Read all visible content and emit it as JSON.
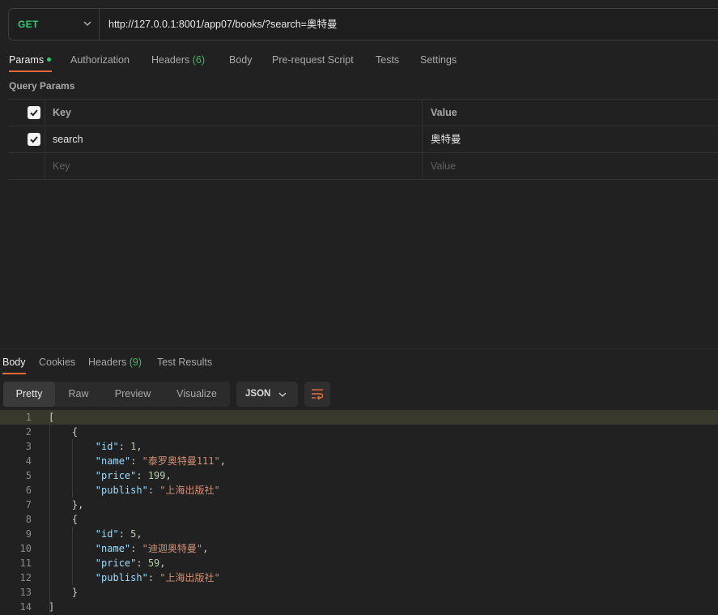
{
  "request": {
    "method": "GET",
    "url": "http://127.0.0.1:8001/app07/books/?search=奥特曼"
  },
  "request_tabs": {
    "params": "Params",
    "authorization": "Authorization",
    "headers": "Headers",
    "headers_count": "(6)",
    "body": "Body",
    "prerequest": "Pre-request Script",
    "tests": "Tests",
    "settings": "Settings"
  },
  "query_params": {
    "title": "Query Params",
    "header_key": "Key",
    "header_value": "Value",
    "rows": [
      {
        "key": "search",
        "value": "奥特曼",
        "checked": true
      }
    ],
    "placeholder_key": "Key",
    "placeholder_value": "Value"
  },
  "response_tabs": {
    "body": "Body",
    "cookies": "Cookies",
    "headers": "Headers",
    "headers_count": "(9)",
    "test_results": "Test Results"
  },
  "view_modes": [
    "Pretty",
    "Raw",
    "Preview",
    "Visualize"
  ],
  "format": "JSON",
  "response_lines": [
    {
      "n": "1",
      "text": "["
    },
    {
      "n": "2",
      "text": "    {"
    },
    {
      "n": "3",
      "key": "id",
      "value": "1",
      "type": "number",
      "comma": true
    },
    {
      "n": "4",
      "key": "name",
      "value": "\"泰罗奥特曼111\"",
      "type": "string",
      "comma": true
    },
    {
      "n": "5",
      "key": "price",
      "value": "199",
      "type": "number",
      "comma": true
    },
    {
      "n": "6",
      "key": "publish",
      "value": "\"上海出版社\"",
      "type": "string",
      "comma": false
    },
    {
      "n": "7",
      "text": "    },"
    },
    {
      "n": "8",
      "text": "    {"
    },
    {
      "n": "9",
      "key": "id",
      "value": "5",
      "type": "number",
      "comma": true
    },
    {
      "n": "10",
      "key": "name",
      "value": "\"迪迦奥特曼\"",
      "type": "string",
      "comma": true
    },
    {
      "n": "11",
      "key": "price",
      "value": "59",
      "type": "number",
      "comma": true
    },
    {
      "n": "12",
      "key": "publish",
      "value": "\"上海出版社\"",
      "type": "string",
      "comma": false
    },
    {
      "n": "13",
      "text": "    }"
    },
    {
      "n": "14",
      "text": "]"
    }
  ],
  "colors": {
    "accent": "#f06a35",
    "method_get": "#2ecc71",
    "json_key": "#9cdcfe",
    "json_string": "#ce9178",
    "json_number": "#b5cea8"
  }
}
